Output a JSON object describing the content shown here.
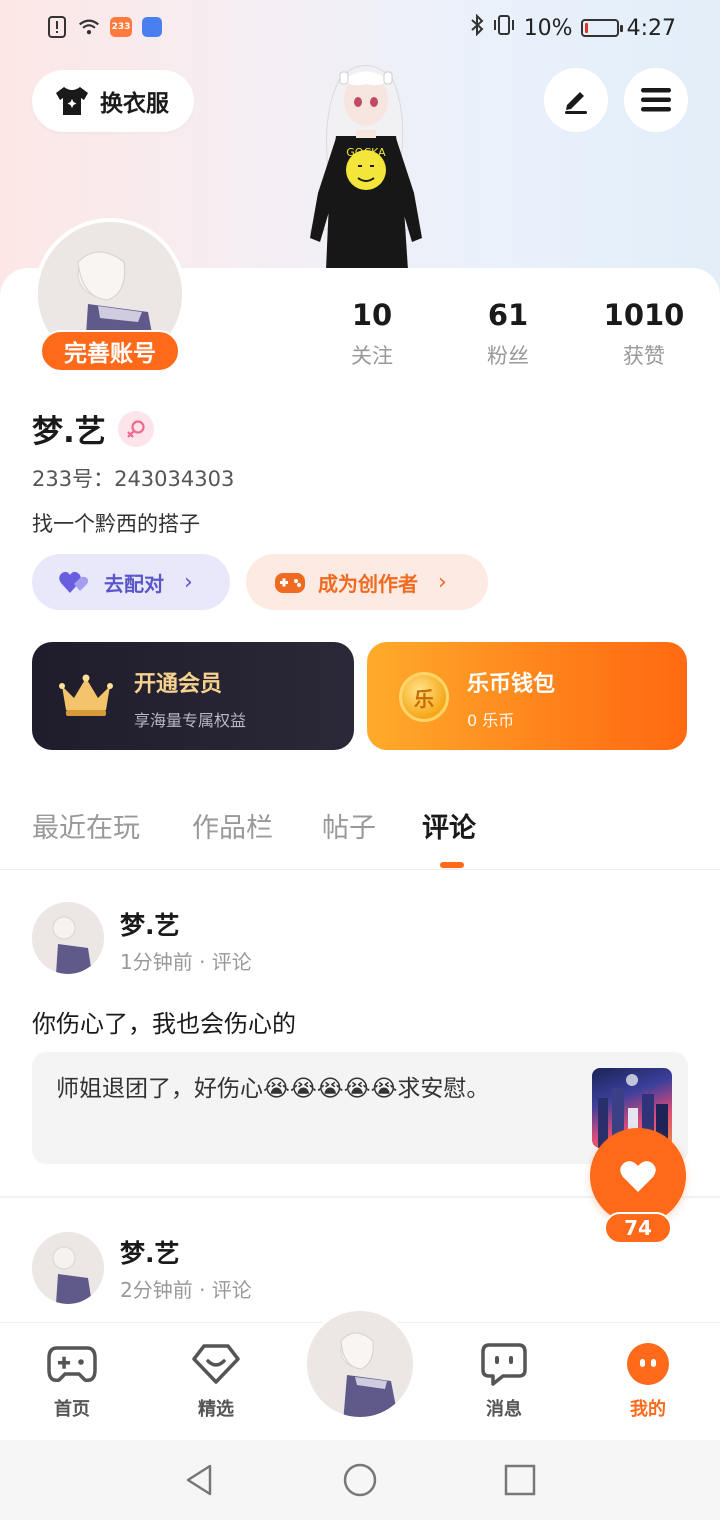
{
  "status_bar": {
    "app_badge": "233",
    "battery": "10%",
    "battery_level": 0.1,
    "time": "4:27"
  },
  "header": {
    "outfit_button": "换衣服"
  },
  "profile": {
    "complete_account": "完善账号",
    "stats": [
      {
        "value": "10",
        "label": "关注"
      },
      {
        "value": "61",
        "label": "粉丝"
      },
      {
        "value": "1010",
        "label": "获赞"
      }
    ],
    "name": "梦.艺",
    "uid": "233号：243034303",
    "bio": "找一个黔西的搭子",
    "match_button": "去配对",
    "creator_button": "成为创作者"
  },
  "cards": {
    "vip_title": "开通会员",
    "vip_sub": "享海量专属权益",
    "wallet_title": "乐币钱包",
    "wallet_sub": "0 乐币",
    "coin_glyph": "乐"
  },
  "tabs": [
    {
      "label": "最近在玩",
      "active": false
    },
    {
      "label": "作品栏",
      "active": false
    },
    {
      "label": "帖子",
      "active": false
    },
    {
      "label": "评论",
      "active": true
    }
  ],
  "feed": [
    {
      "name": "梦.艺",
      "meta": "1分钟前 · 评论",
      "text": "你伤心了，我也会伤心的",
      "quote": "师姐退团了，好伤心😭😭😭😭😭求安慰。"
    },
    {
      "name": "梦.艺",
      "meta": "2分钟前 · 评论"
    }
  ],
  "like_fab": {
    "count": "74"
  },
  "bottom_nav": [
    {
      "label": "首页",
      "icon": "gamepad-icon"
    },
    {
      "label": "精选",
      "icon": "heart-chat-icon"
    },
    {
      "label": "消息",
      "icon": "message-icon"
    },
    {
      "label": "我的",
      "icon": "profile-face-icon",
      "active": true
    }
  ],
  "colors": {
    "accent": "#ff6a1a",
    "match": "#5b57c9",
    "vip_gold": "#f6d28f"
  }
}
